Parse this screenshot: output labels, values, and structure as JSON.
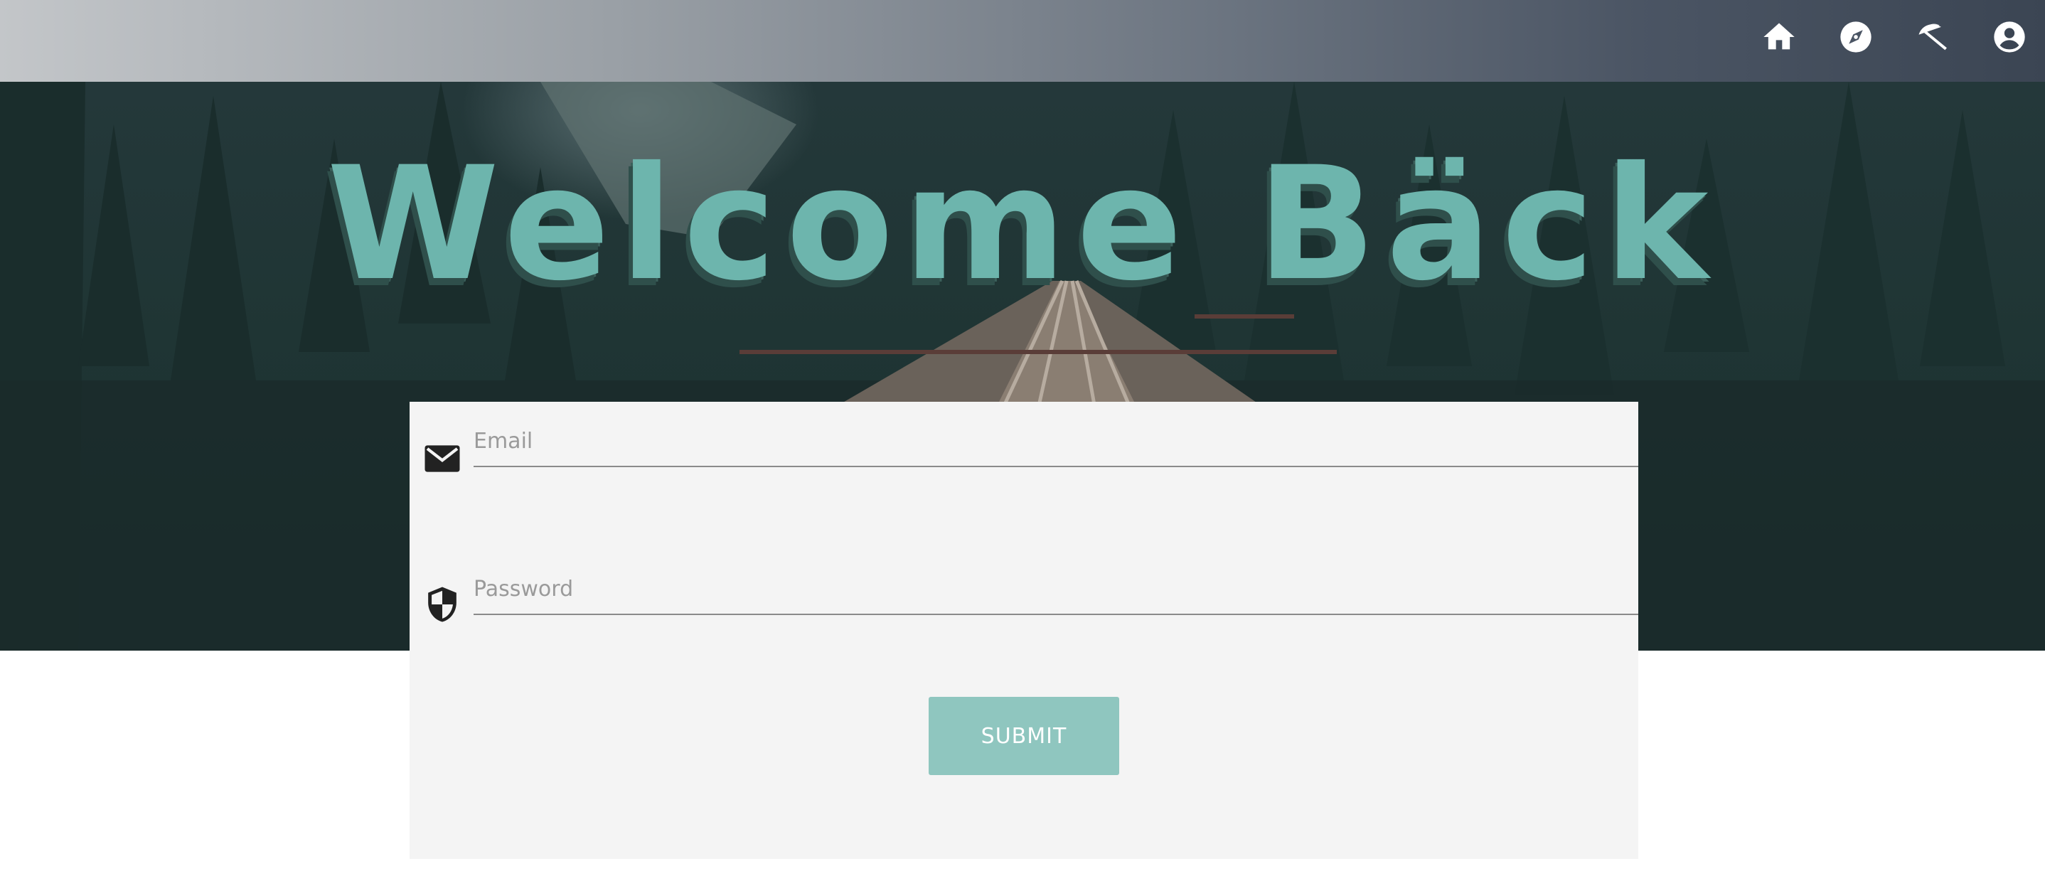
{
  "nav": {
    "icons": [
      "home-icon",
      "compass-icon",
      "beach-umbrella-icon",
      "account-icon"
    ],
    "bar_gradient": [
      "#c3c6c9",
      "#3b4553"
    ]
  },
  "hero": {
    "title": "Welcome Bäck",
    "title_color": "#6db5ad"
  },
  "form": {
    "email": {
      "placeholder": "Email",
      "value": "",
      "icon": "envelope-icon"
    },
    "password": {
      "placeholder": "Password",
      "value": "",
      "icon": "shield-icon"
    },
    "submit_label": "SUBMIT",
    "button_color": "#8fc6bf",
    "card_color": "#f4f4f4"
  }
}
